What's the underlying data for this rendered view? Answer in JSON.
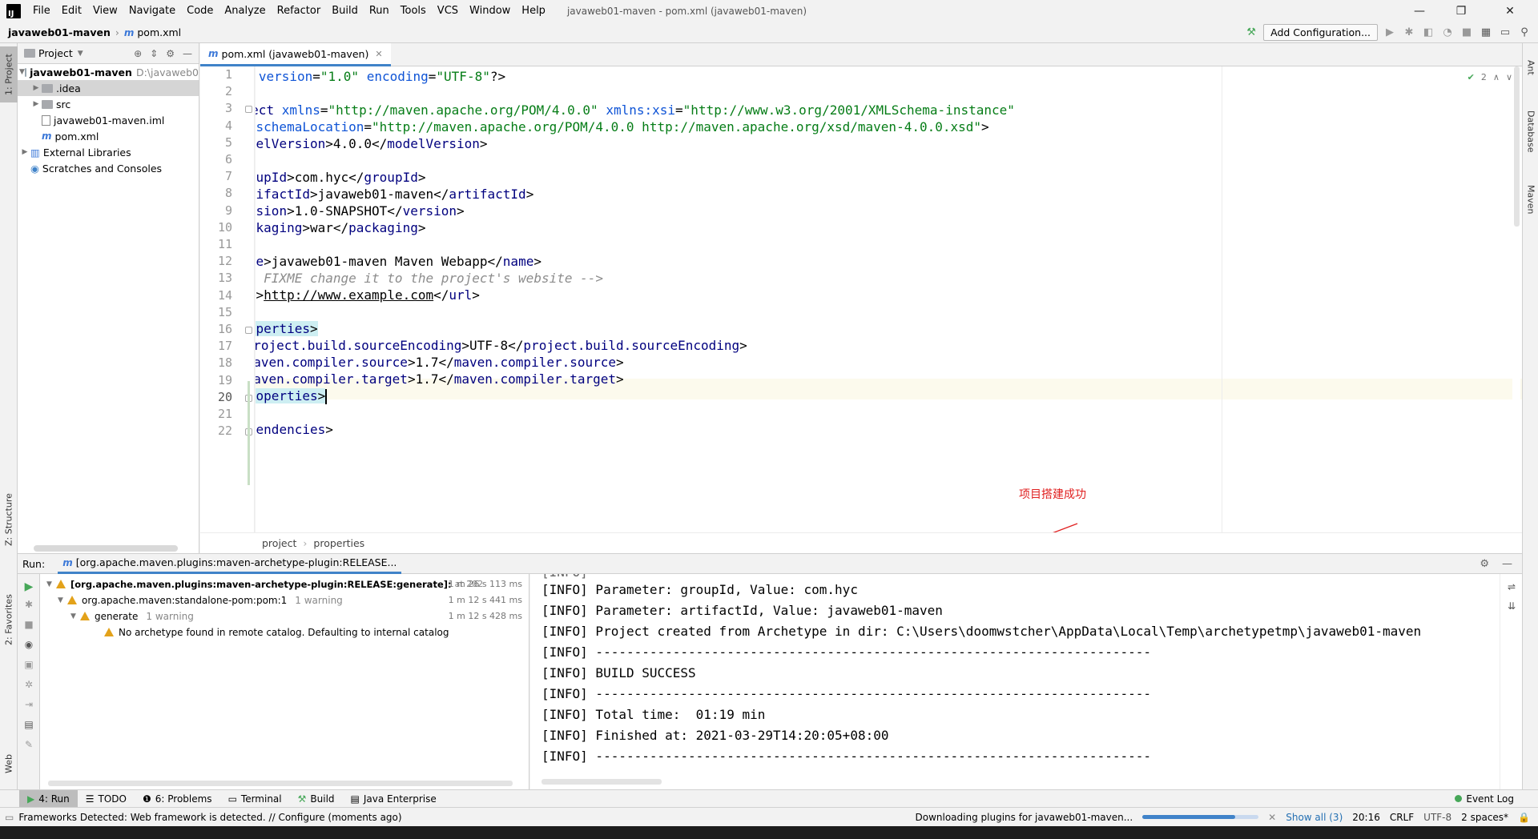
{
  "menu": {
    "items": [
      "File",
      "Edit",
      "View",
      "Navigate",
      "Code",
      "Analyze",
      "Refactor",
      "Build",
      "Run",
      "Tools",
      "VCS",
      "Window",
      "Help"
    ],
    "window_title": "javaweb01-maven - pom.xml (javaweb01-maven)"
  },
  "window_controls": {
    "minimize": "—",
    "maximize": "❐",
    "close": "✕"
  },
  "navbar": {
    "project": "javaweb01-maven",
    "file": "pom.xml",
    "add_configuration": "Add Configuration..."
  },
  "left_stripe": {
    "project": "1: Project",
    "structure": "Z: Structure",
    "favorites": "2: Favorites",
    "web": "Web"
  },
  "right_stripe": {
    "ant": "Ant",
    "database": "Database",
    "maven": "Maven"
  },
  "project_panel": {
    "title": "Project",
    "items": [
      {
        "label": "javaweb01-maven",
        "hint": "D:\\javaweb0"
      },
      {
        "label": ".idea"
      },
      {
        "label": "src"
      },
      {
        "label": "javaweb01-maven.iml"
      },
      {
        "label": "pom.xml"
      },
      {
        "label": "External Libraries"
      },
      {
        "label": "Scratches and Consoles"
      }
    ]
  },
  "editor": {
    "tab_label": "pom.xml (javaweb01-maven)",
    "inspection_count": "2",
    "line_numbers": [
      "1",
      "2",
      "3",
      "4",
      "5",
      "6",
      "7",
      "8",
      "9",
      "10",
      "11",
      "12",
      "13",
      "14",
      "15",
      "16",
      "17",
      "18",
      "19",
      "20",
      "21",
      "22"
    ],
    "breadcrumb": [
      "project",
      "properties"
    ]
  },
  "annotation": {
    "text": "项目搭建成功"
  },
  "run_panel": {
    "label": "Run:",
    "tab_label": "[org.apache.maven.plugins:maven-archetype-plugin:RELEASE...",
    "tree": [
      {
        "label": "[org.apache.maven.plugins:maven-archetype-plugin:RELEASE:generate]:",
        "suffix": "at 202",
        "time": "1 m 26 s 113 ms"
      },
      {
        "label": "org.apache.maven:standalone-pom:pom:1",
        "suffix": "1 warning",
        "time": "1 m 12 s 441 ms"
      },
      {
        "label": "generate",
        "suffix": "1 warning",
        "time": "1 m 12 s 428 ms"
      },
      {
        "label": "No archetype found in remote catalog. Defaulting to internal catalog"
      }
    ],
    "console": [
      "[INFO] Parameter: groupId, Value: com.hyc",
      "[INFO] Parameter: artifactId, Value: javaweb01-maven",
      "[INFO] Project created from Archetype in dir: C:\\Users\\doomwstcher\\AppData\\Local\\Temp\\archetypetmp\\javaweb01-maven",
      "[INFO] ------------------------------------------------------------------------",
      "[INFO] BUILD SUCCESS",
      "[INFO] ------------------------------------------------------------------------",
      "[INFO] Total time:  01:19 min",
      "[INFO] Finished at: 2021-03-29T14:20:05+08:00",
      "[INFO] ------------------------------------------------------------------------"
    ]
  },
  "tool_tabs": {
    "run": "4: Run",
    "todo": "TODO",
    "problems": "6: Problems",
    "terminal": "Terminal",
    "build": "Build",
    "java_enterprise": "Java Enterprise",
    "event_log": "Event Log"
  },
  "statusbar": {
    "message": "Frameworks Detected: Web framework is detected. // Configure (moments ago)",
    "progress_text": "Downloading plugins for javaweb01-maven...",
    "progress": 0.8,
    "show_all": "Show all (3)",
    "position": "20:16",
    "line_sep": "CRLF",
    "encoding": "UTF-8",
    "indent": "2 spaces*"
  },
  "colors": {
    "accent": "#4083c9",
    "success": "#46a758",
    "warning": "#e3a21a",
    "annotation": "#e02020"
  }
}
